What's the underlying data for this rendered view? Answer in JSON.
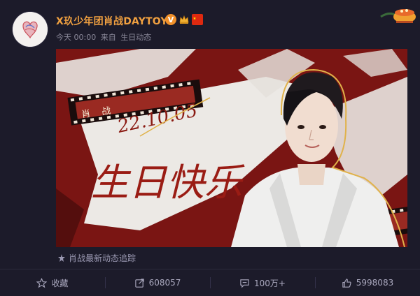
{
  "post": {
    "author": {
      "name": "X玖少年团肖战DAYTOY",
      "badges": [
        "verified-v",
        "crown-icon",
        "china-flag-icon"
      ]
    },
    "time": "今天 00:00",
    "source_prefix": "来自",
    "source": "生日动态",
    "banner": {
      "film_label": "肖 战",
      "date_signature": "22.10.05",
      "greeting_signature": "生日快乐",
      "colors": {
        "red": "#7a1414",
        "paper": "#e9e6e2",
        "gold": "#e0b24a"
      }
    },
    "footer_source": "肖战最新动态追踪",
    "actions": [
      {
        "icon": "star-icon",
        "label": "收藏"
      },
      {
        "icon": "share-icon",
        "label": "608057"
      },
      {
        "icon": "comment-icon",
        "label": "100万+"
      },
      {
        "icon": "like-icon",
        "label": "5998083"
      }
    ]
  },
  "theme": {
    "background": "#1c1b2a",
    "username_color": "#f0a040",
    "meta_color": "#8a8899"
  }
}
